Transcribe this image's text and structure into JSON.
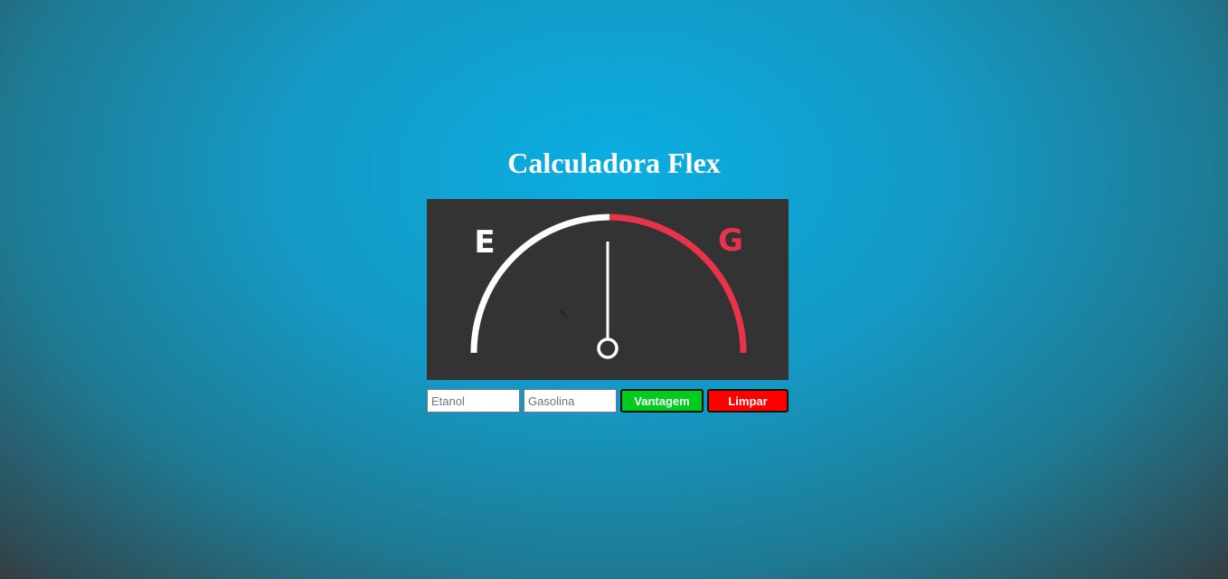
{
  "page": {
    "title": "Calculadora Flex"
  },
  "gauge": {
    "left_label": "E",
    "right_label": "G",
    "left_color": "#ffffff",
    "right_color": "#e8334a",
    "needle_color": "#ffffff",
    "panel_color": "#333333"
  },
  "form": {
    "etanol_placeholder": "Etanol",
    "gasolina_placeholder": "Gasolina",
    "vantagem_label": "Vantagem",
    "limpar_label": "Limpar"
  },
  "colors": {
    "vantagem_button": "#00cc1f",
    "limpar_button": "#ff0000",
    "background_center": "#0aaee2",
    "background_edge": "#363c3e"
  }
}
